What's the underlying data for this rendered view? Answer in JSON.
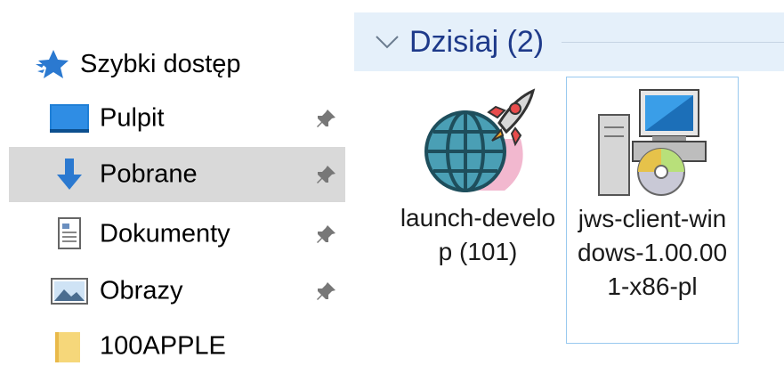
{
  "nav": {
    "quick_access": "Szybki dostęp",
    "items": [
      {
        "label": "Pulpit",
        "icon": "desktop-icon",
        "pinned": true
      },
      {
        "label": "Pobrane",
        "icon": "downloads-icon",
        "pinned": true,
        "selected": true
      },
      {
        "label": "Dokumenty",
        "icon": "documents-icon",
        "pinned": true
      },
      {
        "label": "Obrazy",
        "icon": "pictures-icon",
        "pinned": true
      },
      {
        "label": "100APPLE",
        "icon": "folder-icon",
        "pinned": false
      }
    ]
  },
  "content": {
    "group_title": "Dzisiaj (2)",
    "files": [
      {
        "name": "launch-develop (101)",
        "icon": "globe-rocket-icon"
      },
      {
        "name": "jws-client-windows-1.00.001-x86-pl",
        "icon": "installer-icon",
        "selected": true
      }
    ]
  },
  "colors": {
    "accent": "#1e3a8a",
    "group_header_bg": "#e5f0fa",
    "selected_nav_bg": "#d9d9d9",
    "selection_border": "#99c9ef"
  }
}
